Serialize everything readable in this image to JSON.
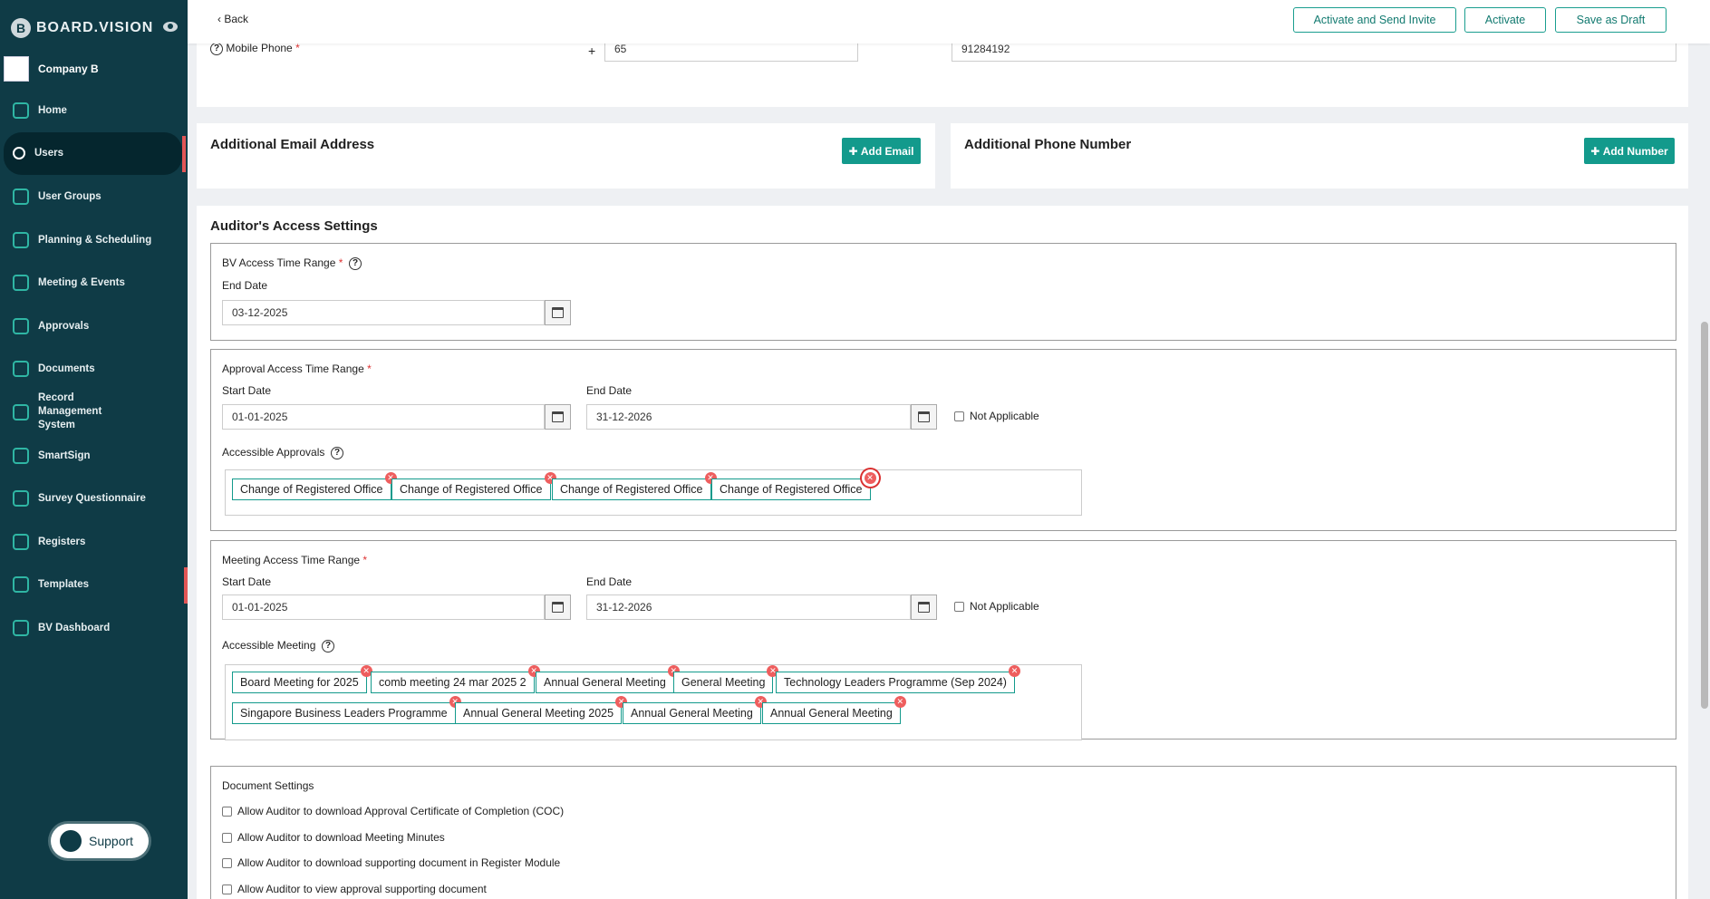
{
  "sidebar": {
    "brand": "BOARD.VISION",
    "company": "Company B",
    "items": [
      {
        "label": "Home",
        "icon": "home-icon"
      },
      {
        "label": "Users",
        "icon": "user-icon"
      },
      {
        "label": "User Groups",
        "icon": "users-icon"
      },
      {
        "label": "Planning & Scheduling",
        "icon": "chart-icon"
      },
      {
        "label": "Meeting & Events",
        "icon": "calendar-icon"
      },
      {
        "label": "Approvals",
        "icon": "approval-icon"
      },
      {
        "label": "Documents",
        "icon": "document-icon"
      },
      {
        "label": "Record Management System",
        "icon": "record-icon"
      },
      {
        "label": "SmartSign",
        "icon": "sign-icon"
      },
      {
        "label": "Survey Questionnaire",
        "icon": "survey-icon"
      },
      {
        "label": "Registers",
        "icon": "registers-icon"
      },
      {
        "label": "Templates",
        "icon": "template-icon"
      },
      {
        "label": "BV Dashboard",
        "icon": "dashboard-icon"
      }
    ],
    "support": "Support"
  },
  "topbar": {
    "back": "Back",
    "activate_invite": "Activate and Send Invite",
    "activate": "Activate",
    "save_draft": "Save as Draft"
  },
  "phone": {
    "label": "Mobile Phone",
    "plus": "+",
    "code": "65",
    "number": "91284192"
  },
  "additional": {
    "email_title": "Additional Email Address",
    "email_btn": "Add Email",
    "phone_title": "Additional Phone Number",
    "phone_btn": "Add Number"
  },
  "auditor": {
    "title": "Auditor's Access Settings",
    "bv": {
      "label": "BV Access Time Range",
      "end_label": "End Date",
      "end": "03-12-2025"
    },
    "approval": {
      "label": "Approval Access Time Range",
      "start_label": "Start Date",
      "start": "01-01-2025",
      "end_label": "End Date",
      "end": "31-12-2026",
      "na": "Not Applicable",
      "accessible_label": "Accessible Approvals",
      "tags": [
        "Change of Registered Office",
        "Change of Registered Office",
        "Change of Registered Office",
        "Change of Registered Office"
      ]
    },
    "meeting": {
      "label": "Meeting Access Time Range",
      "start_label": "Start Date",
      "start": "01-01-2025",
      "end_label": "End Date",
      "end": "31-12-2026",
      "na": "Not Applicable",
      "accessible_label": "Accessible Meeting",
      "tags": [
        "Board Meeting for 2025",
        "comb meeting 24 mar 2025 2",
        "Annual General Meeting",
        "General Meeting",
        "Technology Leaders Programme (Sep 2024)",
        "Singapore Business Leaders Programme",
        "Annual General Meeting 2025",
        "Annual General Meeting",
        "Annual General Meeting"
      ]
    },
    "documents": {
      "title": "Document Settings",
      "options": [
        "Allow Auditor to download Approval Certificate of Completion (COC)",
        "Allow Auditor to download Meeting Minutes",
        "Allow Auditor to download supporting document in Register Module",
        "Allow Auditor to view approval supporting document"
      ]
    }
  }
}
